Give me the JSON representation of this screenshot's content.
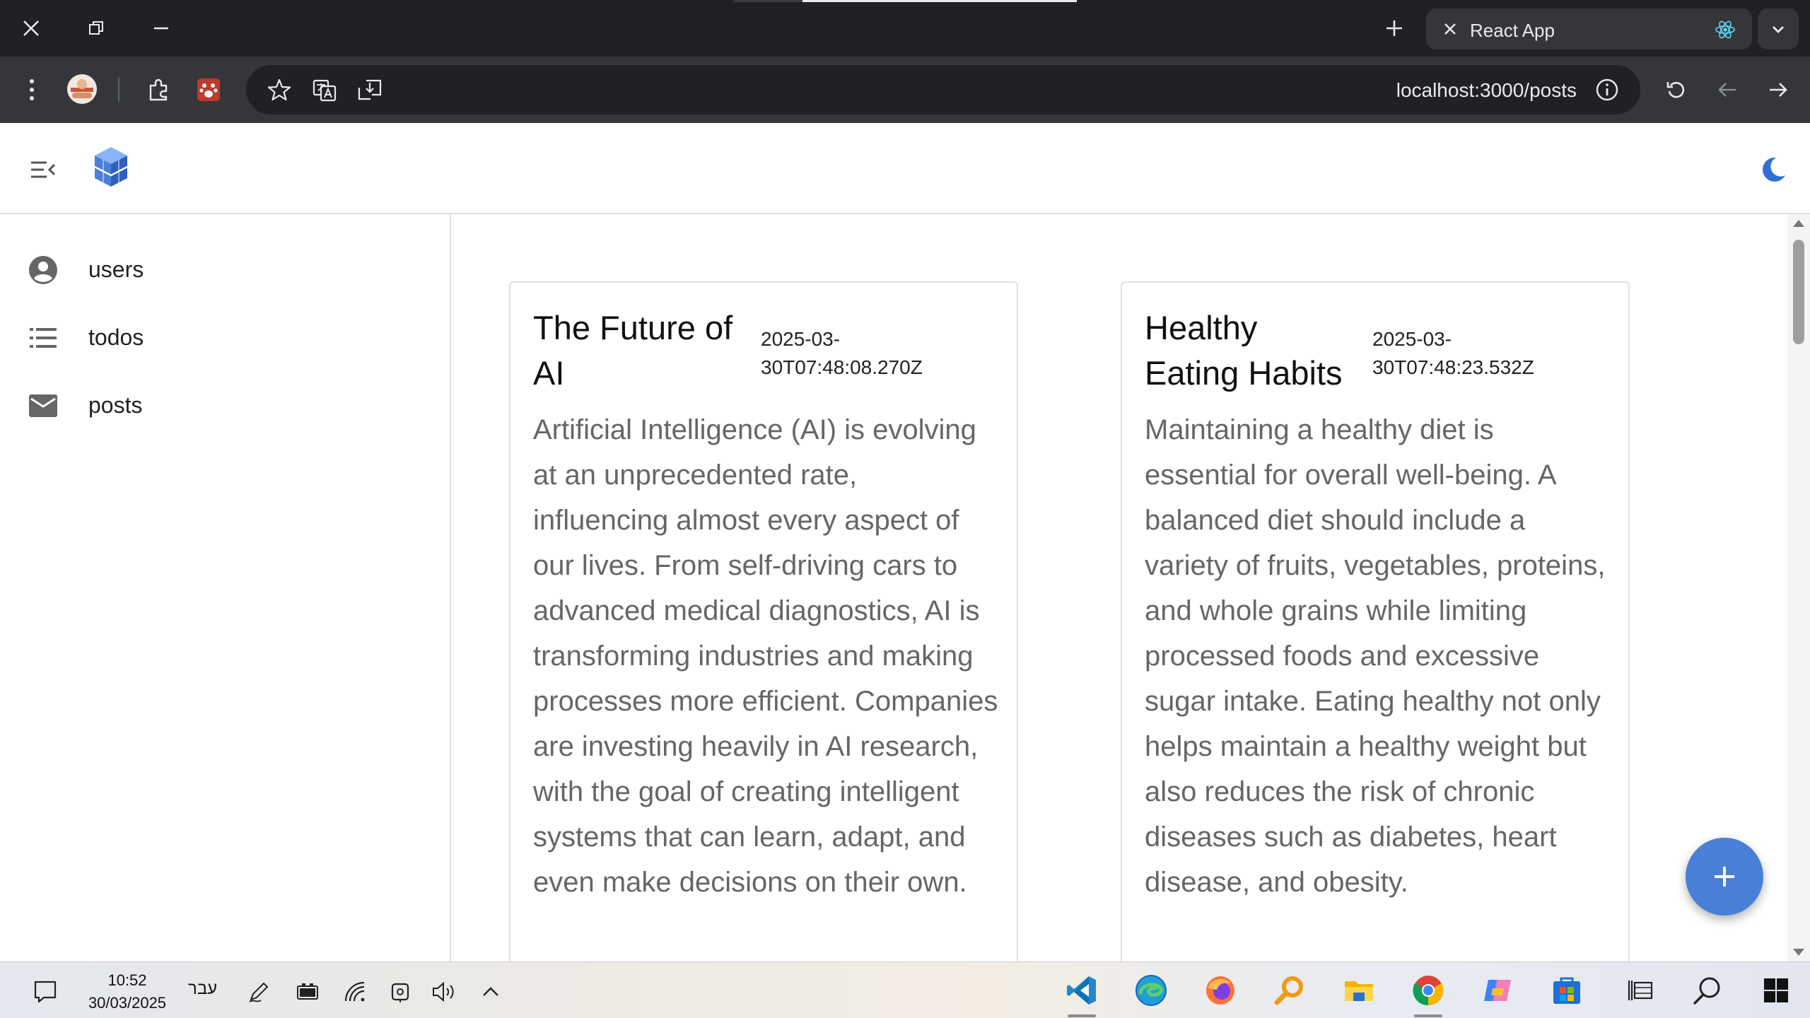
{
  "browser": {
    "tab_title": "React App",
    "url": "localhost:3000/posts"
  },
  "sidebar": {
    "items": [
      {
        "label": "users",
        "icon": "account-circle-icon"
      },
      {
        "label": "todos",
        "icon": "list-icon"
      },
      {
        "label": "posts",
        "icon": "mail-icon"
      }
    ]
  },
  "posts": [
    {
      "title": "The Future of AI",
      "date": "2025-03-30T07:48:08.270Z",
      "body": "Artificial Intelligence (AI) is evolving at an unprecedented rate, influencing almost every aspect of our lives. From self-driving cars to advanced medical diagnostics, AI is transforming industries and making processes more efficient. Companies are investing heavily in AI research, with the goal of creating intelligent systems that can learn, adapt, and even make decisions on their own."
    },
    {
      "title": "Healthy Eating Habits",
      "date": "2025-03-30T07:48:23.532Z",
      "body": "Maintaining a healthy diet is essential for overall well-being. A balanced diet should include a variety of fruits, vegetables, proteins, and whole grains while limiting processed foods and excessive sugar intake. Eating healthy not only helps maintain a healthy weight but also reduces the risk of chronic diseases such as diabetes, heart disease, and obesity."
    }
  ],
  "taskbar": {
    "time": "10:52",
    "date": "30/03/2025",
    "language": "עבר"
  },
  "colors": {
    "accent": "#4a7fd8",
    "chrome_dark": "#202124",
    "chrome_toolbar": "#35363a"
  }
}
